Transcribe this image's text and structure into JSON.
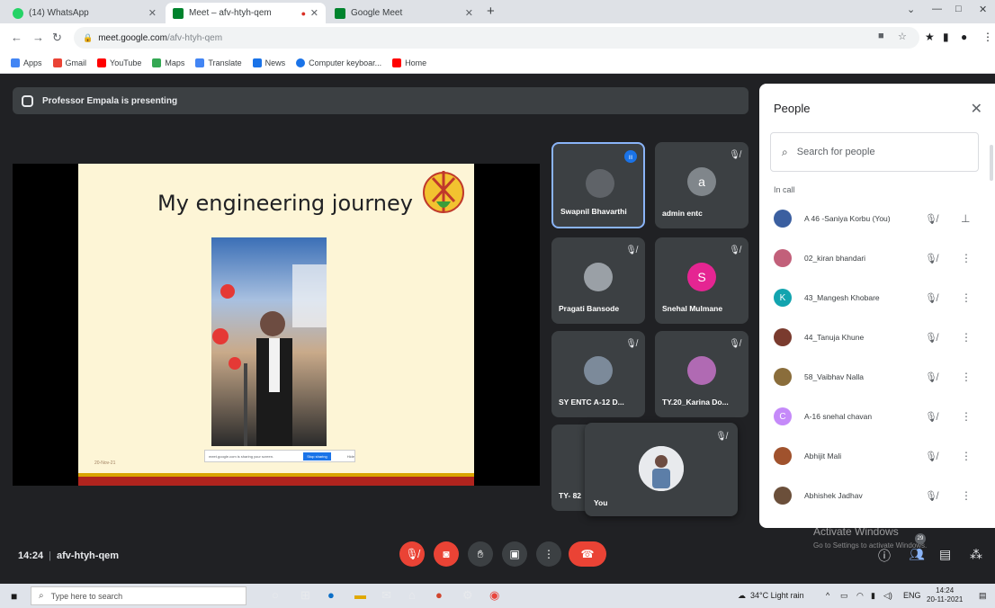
{
  "browser": {
    "tabs": [
      {
        "label": "(14) WhatsApp",
        "icon": "whatsapp-icon",
        "color": "#25d366"
      },
      {
        "label": "Meet – afv-htyh-qem",
        "icon": "meet-icon",
        "color": "#00832d"
      },
      {
        "label": "Google Meet",
        "icon": "meet-icon",
        "color": "#00832d"
      }
    ],
    "url_host": "meet.google.com",
    "url_path": "/afv-htyh-qem",
    "bookmarks": [
      {
        "label": "Apps",
        "icon": "apps-icon",
        "color": "#4285f4"
      },
      {
        "label": "Gmail",
        "icon": "gmail-icon",
        "color": "#ea4335"
      },
      {
        "label": "YouTube",
        "icon": "youtube-icon",
        "color": "#ff0000"
      },
      {
        "label": "Maps",
        "icon": "maps-icon",
        "color": "#34a853"
      },
      {
        "label": "Translate",
        "icon": "translate-icon",
        "color": "#4285f4"
      },
      {
        "label": "News",
        "icon": "news-icon",
        "color": "#1a73e8"
      },
      {
        "label": "Computer keyboar...",
        "icon": "keyboard-icon",
        "color": "#1a73e8"
      },
      {
        "label": "Home",
        "icon": "youtube-icon",
        "color": "#ff0000"
      }
    ]
  },
  "meet": {
    "presenting_banner": "Professor Empala is presenting",
    "slide": {
      "title": "My engineering journey",
      "share_text": "meet.google.com is sharing your screen.",
      "stop_label": "Stop sharing",
      "hide_label": "Hide",
      "date": "20-Nov-21"
    },
    "tiles": [
      {
        "name": "Swapnil Bhavarthi",
        "avatar_letter": "",
        "avatar_color": "#5f6368",
        "speaking": true
      },
      {
        "name": "admin entc",
        "avatar_letter": "a",
        "avatar_color": "#80868b"
      },
      {
        "name": "Pragati Bansode",
        "avatar_letter": "",
        "avatar_color": "#9aa0a6"
      },
      {
        "name": "Snehal Mulmane",
        "avatar_letter": "S",
        "avatar_color": "#e52592"
      },
      {
        "name": "SY ENTC A-12 D...",
        "avatar_letter": "",
        "avatar_color": "#7c8a9a"
      },
      {
        "name": "TY.20_Karina Do...",
        "avatar_letter": "",
        "avatar_color": "#b06ab3"
      },
      {
        "name": "TY- 82",
        "avatar_letter": "",
        "avatar_color": "#3c4043"
      }
    ],
    "self_tile": {
      "name": "You"
    },
    "meeting_time": "14:24",
    "meeting_code": "afv-htyh-qem",
    "people_badge": "29"
  },
  "people_panel": {
    "title": "People",
    "search_placeholder": "Search for people",
    "section_label": "In call",
    "participants": [
      {
        "name": "A 46 -Saniya Korbu (You)",
        "avatar_letter": "",
        "avatar_color": "#3b5fa0"
      },
      {
        "name": "02_kiran bhandari",
        "avatar_letter": "",
        "avatar_color": "#c2607a"
      },
      {
        "name": "43_Mangesh Khobare",
        "avatar_letter": "K",
        "avatar_color": "#12a4af"
      },
      {
        "name": "44_Tanuja Khune",
        "avatar_letter": "",
        "avatar_color": "#7a3b2e"
      },
      {
        "name": "58_Vaibhav Nalla",
        "avatar_letter": "",
        "avatar_color": "#8a6d3b"
      },
      {
        "name": "A-16 snehal chavan",
        "avatar_letter": "C",
        "avatar_color": "#c58af9"
      },
      {
        "name": "Abhijit Mali",
        "avatar_letter": "",
        "avatar_color": "#a0522d"
      },
      {
        "name": "Abhishek Jadhav",
        "avatar_letter": "",
        "avatar_color": "#6b4f3a"
      }
    ]
  },
  "watermark": {
    "line1": "Activate Windows",
    "line2": "Go to Settings to activate Windows."
  },
  "taskbar": {
    "search_placeholder": "Type here to search",
    "weather": "34°C Light rain",
    "lang": "ENG",
    "time": "14:24",
    "date": "20-11-2021"
  }
}
